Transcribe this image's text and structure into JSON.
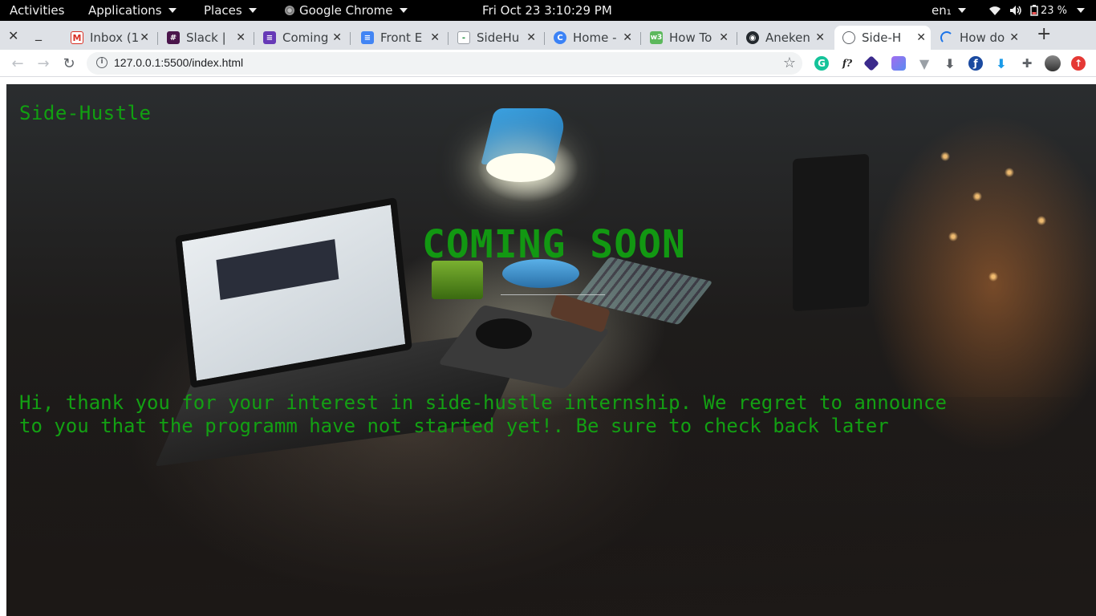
{
  "system_bar": {
    "activities": "Activities",
    "applications": "Applications",
    "places": "Places",
    "active_app": "Google Chrome",
    "clock": "Fri Oct 23   3:10:29 PM",
    "keyboard_layout": "en₁",
    "battery": "23 %"
  },
  "browser": {
    "tabs": [
      {
        "label": "Inbox (1",
        "icon": "gmail-icon"
      },
      {
        "label": "Slack |",
        "icon": "slack-icon"
      },
      {
        "label": "Coming",
        "icon": "forms-icon"
      },
      {
        "label": "Front E",
        "icon": "docs-icon"
      },
      {
        "label": "SideHu",
        "icon": "page-icon"
      },
      {
        "label": "Home -",
        "icon": "canva-icon"
      },
      {
        "label": "How To",
        "icon": "codepen-icon"
      },
      {
        "label": "Aneken",
        "icon": "github-icon"
      },
      {
        "label": "Side-H",
        "icon": "globe-icon"
      },
      {
        "label": "How do",
        "icon": "loading-icon"
      }
    ],
    "active_tab_index": 8,
    "url": "127.0.0.1:5500/index.html"
  },
  "page": {
    "brand": "Side-Hustle",
    "headline": "COMING SOON",
    "message_line1": "Hi, thank you for your interest in side-hustle internship. We regret to announce",
    "message_line2": "to you that the programm have not started yet!. Be sure to check back later",
    "text_color": "#13a013"
  }
}
